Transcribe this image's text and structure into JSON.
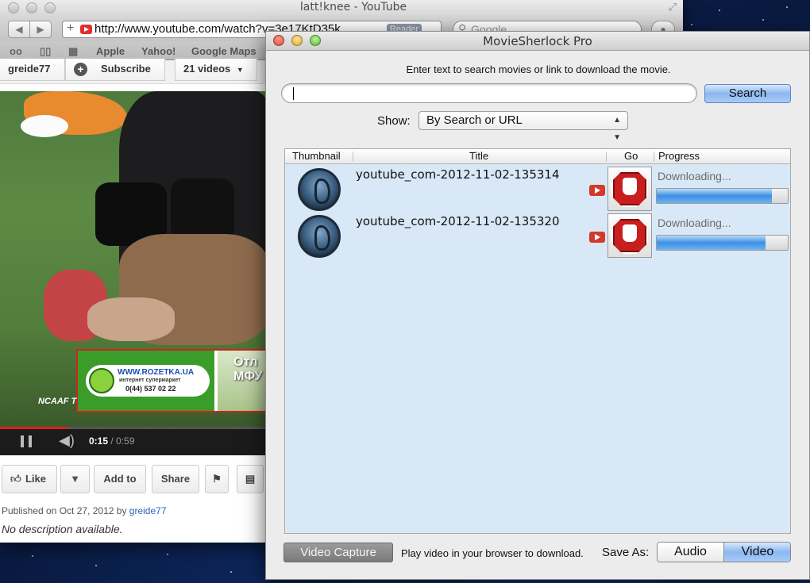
{
  "safari": {
    "title": "latt!knee - YouTube",
    "url": "http://www.youtube.com/watch?v=3e17KtD35k",
    "reader_label": "Reader",
    "search_placeholder": "Google",
    "bookmarks": [
      "Apple",
      "Yahoo!",
      "Google Maps"
    ],
    "channel": "greide77",
    "subscribe_label": "Subscribe",
    "videos_count": "21 videos",
    "ad": {
      "site": "WWW.ROZETKA.UA",
      "tagline": "интернет супермаркет",
      "phone": "0(44) 537 02 22",
      "right_text": "Отл МФУ"
    },
    "overlay_text": "NCAAF T",
    "time_current": "0:15",
    "time_total": "/ 0:59",
    "progress_fraction": 0.25,
    "actions": {
      "like": "Like",
      "add_to": "Add to",
      "share": "Share"
    },
    "published_prefix": "Published on Oct 27, 2012 by ",
    "published_author": "greide77",
    "description": "No description available."
  },
  "moviesherlock": {
    "title": "MovieSherlock Pro",
    "instructions": "Enter text to search movies or link to download the movie.",
    "search_value": "",
    "search_button": "Search",
    "show_label": "Show:",
    "show_value": "By Search or URL",
    "columns": [
      "Thumbnail",
      "Title",
      "Go",
      "Progress"
    ],
    "rows": [
      {
        "title": "youtube_com-2012-11-02-135314",
        "status": "Downloading...",
        "progress": 0.88
      },
      {
        "title": "youtube_com-2012-11-02-135320",
        "status": "Downloading...",
        "progress": 0.83
      }
    ],
    "video_capture_button": "Video Capture",
    "play_note": "Play video in your browser to download.",
    "save_as_label": "Save As:",
    "save_options": [
      "Audio",
      "Video"
    ],
    "save_selected": "Video"
  },
  "colors": {
    "accent_blue": "#8cb8f0",
    "stop_red": "#c81e1e",
    "desktop": "#0d2457"
  }
}
